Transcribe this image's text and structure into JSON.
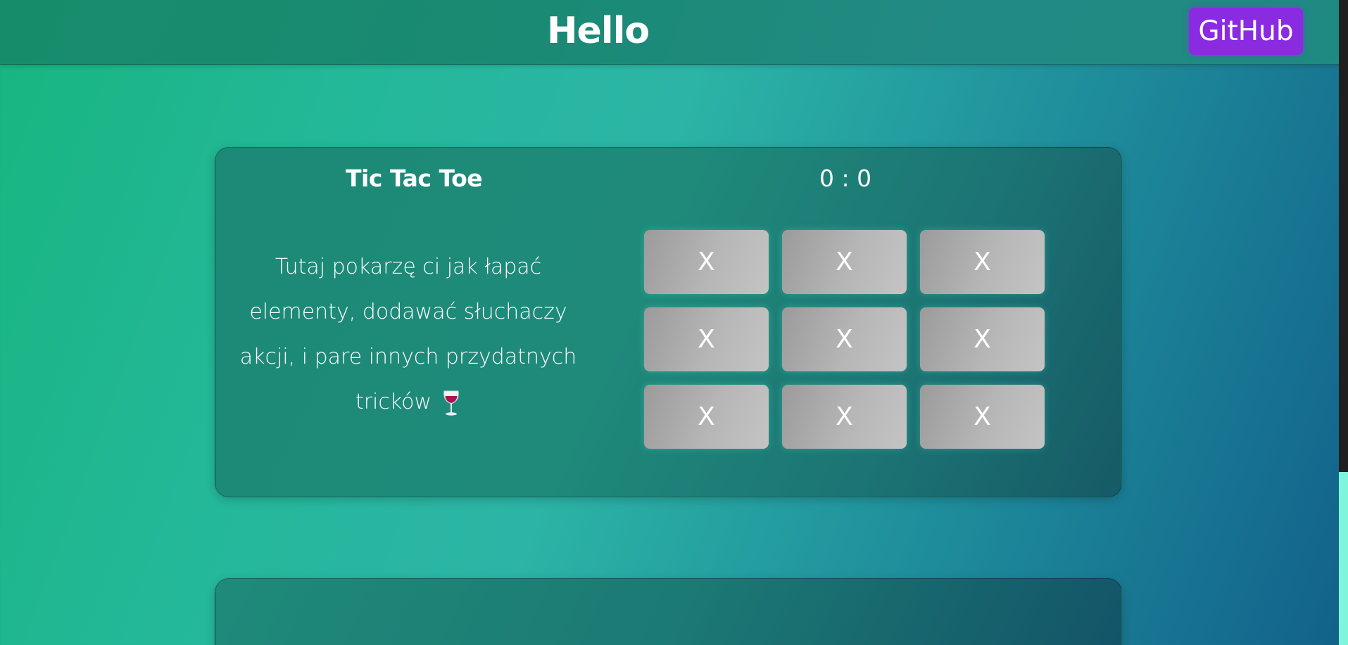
{
  "header": {
    "title": "Hello",
    "github_label": "GitHub"
  },
  "game": {
    "title": "Tic Tac Toe",
    "score": "0 : 0",
    "description": "Tutaj pokarzę ci jak łapać elementy, dodawać słuchaczy akcji, i pare innych przydatnych tricków",
    "description_icon": "wine-glass-icon",
    "board": [
      "X",
      "X",
      "X",
      "X",
      "X",
      "X",
      "X",
      "X",
      "X"
    ]
  },
  "colors": {
    "github_button": "#8a2be2",
    "card": "#1f8a7a",
    "cell": "#b0b0b0",
    "scroll_thumb": "#7ff5dc"
  }
}
